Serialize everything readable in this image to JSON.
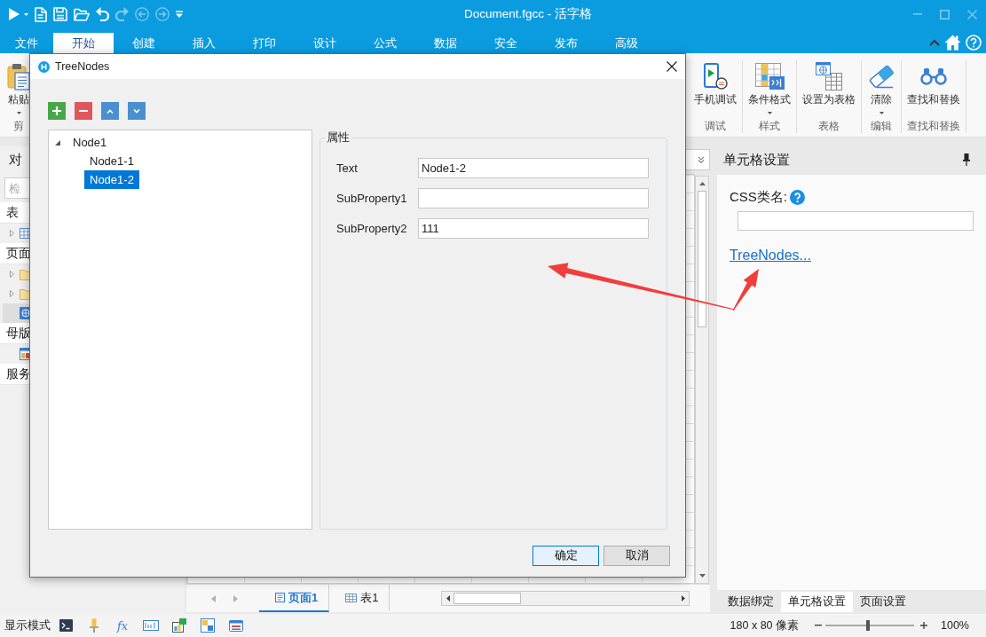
{
  "window": {
    "title": "Document.fgcc - 活字格"
  },
  "quick_access": [
    {
      "kind": "run",
      "disabled": false
    },
    {
      "kind": "new",
      "disabled": false
    },
    {
      "kind": "save",
      "disabled": false
    },
    {
      "kind": "open",
      "disabled": false
    },
    {
      "kind": "undo",
      "disabled": false
    },
    {
      "kind": "redo",
      "disabled": true
    },
    {
      "kind": "back",
      "disabled": true
    },
    {
      "kind": "forward",
      "disabled": true
    },
    {
      "kind": "customize",
      "disabled": false
    }
  ],
  "ribbon": {
    "tabs": [
      {
        "label": "文件",
        "selected": false
      },
      {
        "label": "开始",
        "selected": true
      },
      {
        "label": "创建",
        "selected": false
      },
      {
        "label": "插入",
        "selected": false
      },
      {
        "label": "打印",
        "selected": false
      },
      {
        "label": "设计",
        "selected": false
      },
      {
        "label": "公式",
        "selected": false
      },
      {
        "label": "数据",
        "selected": false
      },
      {
        "label": "安全",
        "selected": false
      },
      {
        "label": "发布",
        "selected": false
      },
      {
        "label": "高级",
        "selected": false
      }
    ],
    "clipboard_group": {
      "label": "剪",
      "buttons": [
        {
          "kind": "paste",
          "label": "粘贴",
          "dropdown": true
        }
      ]
    },
    "groups": [
      {
        "label": "调试",
        "buttons": [
          {
            "kind": "phone",
            "label": "手机调试",
            "dropdown": false
          }
        ]
      },
      {
        "label": "样式",
        "buttons": [
          {
            "kind": "conditional",
            "label": "条件格式",
            "dropdown": true
          }
        ]
      },
      {
        "label": "表格",
        "buttons": [
          {
            "kind": "table",
            "label": "设置为表格",
            "dropdown": false
          }
        ]
      },
      {
        "label": "编辑",
        "buttons": [
          {
            "kind": "eraser",
            "label": "清除",
            "dropdown": true
          }
        ]
      },
      {
        "label": "查找和替换",
        "buttons": [
          {
            "kind": "binoculars",
            "label": "查找和替换",
            "dropdown": false
          }
        ]
      }
    ]
  },
  "object_panel": {
    "title": "对",
    "search": {
      "placeholder": "检"
    },
    "sections": [
      {
        "label": "表",
        "items": [
          {
            "kind": "table",
            "expandable": true,
            "selected": false
          }
        ]
      },
      {
        "label": "页面",
        "items": [
          {
            "kind": "folder",
            "expandable": true,
            "selected": false
          },
          {
            "kind": "folder",
            "expandable": true,
            "selected": false
          },
          {
            "kind": "web_page",
            "expandable": false,
            "selected": true
          }
        ]
      },
      {
        "label": "母版",
        "items": [
          {
            "kind": "master_page",
            "expandable": false,
            "selected": false
          }
        ]
      },
      {
        "label": "服务"
      }
    ]
  },
  "sheet_tabs": [
    {
      "kind": "page",
      "label": "页面1",
      "selected": true
    },
    {
      "kind": "table",
      "label": "表1",
      "selected": false
    }
  ],
  "cell_settings": {
    "title": "单元格设置",
    "css_class_label": "CSS类名:",
    "link": "TreeNodes..."
  },
  "panel_tabs": [
    {
      "label": "数据绑定",
      "selected": false
    },
    {
      "label": "单元格设置",
      "selected": true
    },
    {
      "label": "页面设置",
      "selected": false
    }
  ],
  "status_bar": {
    "mode_label": "显示模式",
    "tools": [
      {
        "kind": "terminal"
      },
      {
        "kind": "pin"
      },
      {
        "kind": "formula",
        "glyph": "fx"
      },
      {
        "kind": "textbox"
      },
      {
        "kind": "chart"
      },
      {
        "kind": "data"
      },
      {
        "kind": "form"
      }
    ],
    "dimensions": "180 x 80 像素",
    "zoom": {
      "level": 0.48,
      "reading": "100%"
    }
  },
  "dialog": {
    "title": "TreeNodes",
    "toolbar": [
      {
        "kind": "add"
      },
      {
        "kind": "remove"
      },
      {
        "kind": "move_up"
      },
      {
        "kind": "move_down"
      }
    ],
    "tree": [
      {
        "label": "Node1",
        "expanded": true,
        "selected": false,
        "children": [
          {
            "label": "Node1-1",
            "selected": false
          },
          {
            "label": "Node1-2",
            "selected": true
          }
        ]
      }
    ],
    "properties": {
      "title": "属性",
      "fields": [
        {
          "label": "Text",
          "value": "Node1-2"
        },
        {
          "label": "SubProperty1"
        },
        {
          "label": "SubProperty2",
          "value": "111"
        }
      ]
    },
    "buttons": [
      {
        "label": "确定",
        "default": true
      },
      {
        "label": "取消",
        "default": false
      }
    ]
  }
}
